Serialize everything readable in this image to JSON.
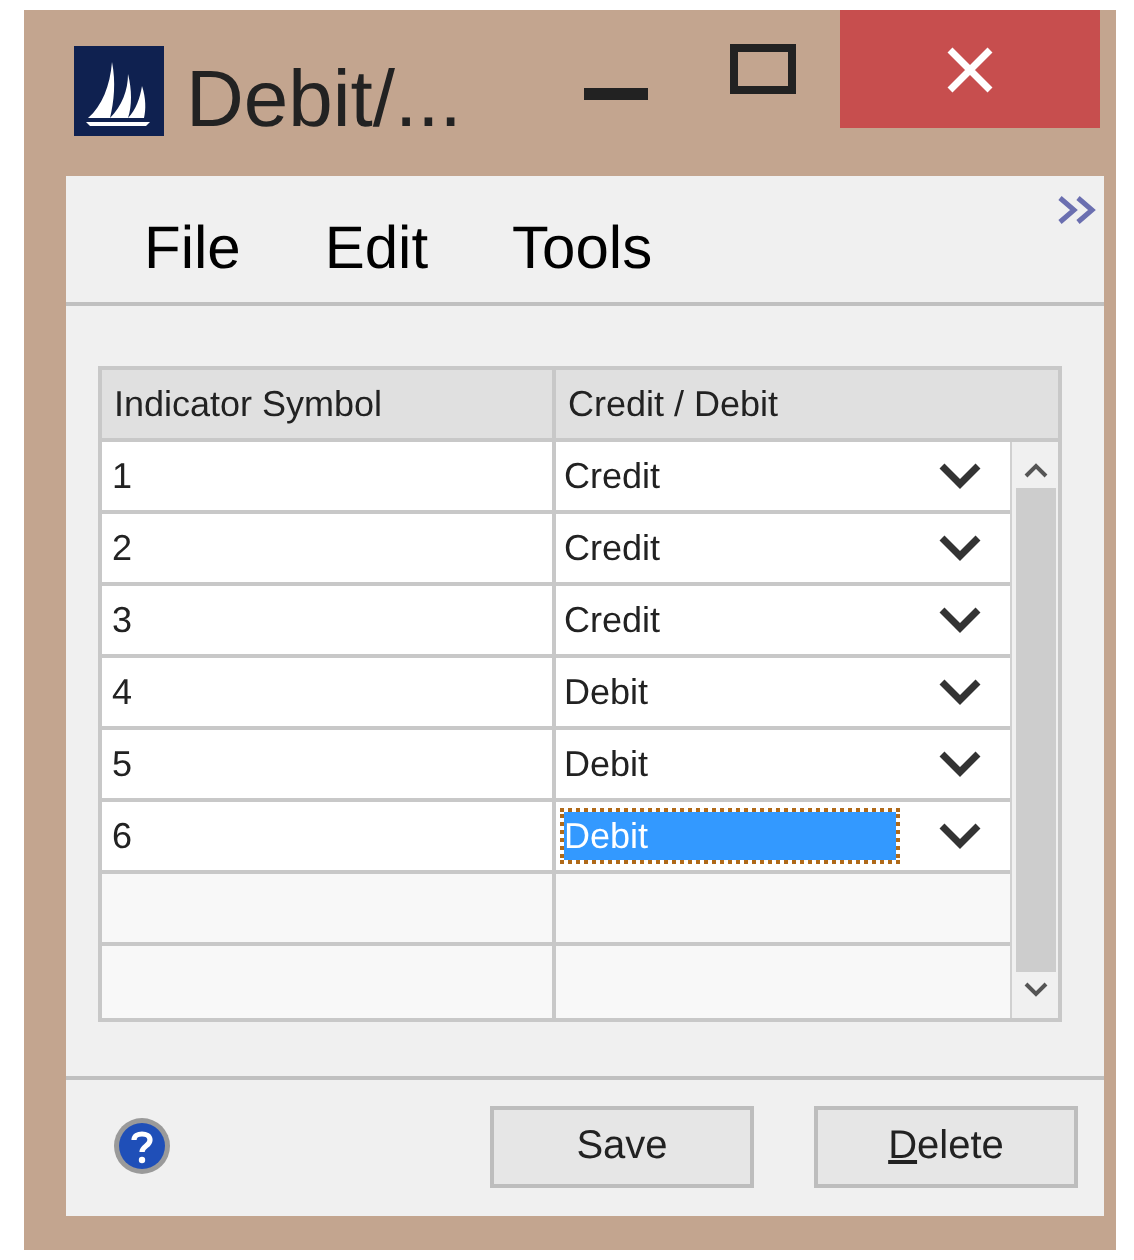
{
  "window": {
    "title": "Debit/..."
  },
  "menu": [
    {
      "label": "File"
    },
    {
      "label": "Edit"
    },
    {
      "label": "Tools"
    }
  ],
  "table": {
    "columns": [
      "Indicator Symbol",
      "Credit / Debit"
    ],
    "rows": [
      {
        "symbol": "1",
        "type": "Credit",
        "selected": false
      },
      {
        "symbol": "2",
        "type": "Credit",
        "selected": false
      },
      {
        "symbol": "3",
        "type": "Credit",
        "selected": false
      },
      {
        "symbol": "4",
        "type": "Debit",
        "selected": false
      },
      {
        "symbol": "5",
        "type": "Debit",
        "selected": false
      },
      {
        "symbol": "6",
        "type": "Debit",
        "selected": true
      }
    ]
  },
  "buttons": [
    {
      "label": "Save"
    },
    {
      "label": "Delete"
    }
  ]
}
